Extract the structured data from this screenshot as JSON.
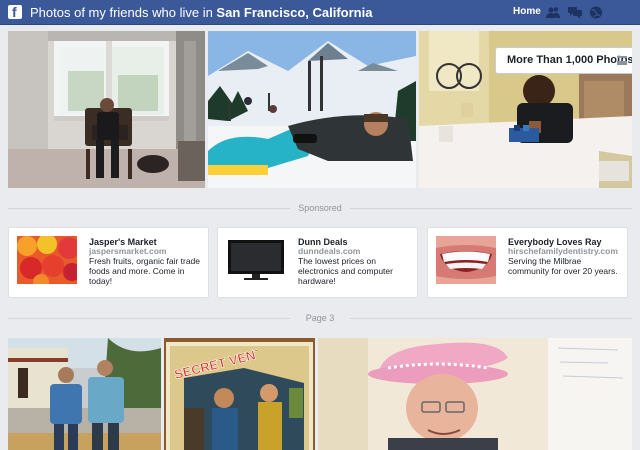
{
  "header": {
    "title_prefix": "Photos of my friends who live in ",
    "title_location": "San Francisco, California",
    "home_label": "Home",
    "icons": [
      "friends-icon",
      "messages-icon",
      "globe-icon"
    ]
  },
  "results_badge": {
    "label": "More Than 1,000 Photos",
    "icon": "menu-icon"
  },
  "sponsored_label": "Sponsored",
  "ads": [
    {
      "name": "Jasper's Market",
      "url": "jaspersmarket.com",
      "desc": "Fresh fruits, organic fair trade foods and more. Come in today!",
      "icon": "fruit-image"
    },
    {
      "name": "Dunn Deals",
      "url": "dunndeals.com",
      "desc": "The lowest prices on electronics and computer hardware!",
      "icon": "tv-image"
    },
    {
      "name": "Everybody Loves Ray",
      "url": "hirschefamilydentistry.com",
      "desc": "Serving the Milbrae community for over 20 years.",
      "icon": "smile-image"
    }
  ],
  "page_label": "Page 3",
  "poster_text": "SECRET VENTURE",
  "colors": {
    "brand": "#3b5998",
    "background": "#e9ebee"
  }
}
